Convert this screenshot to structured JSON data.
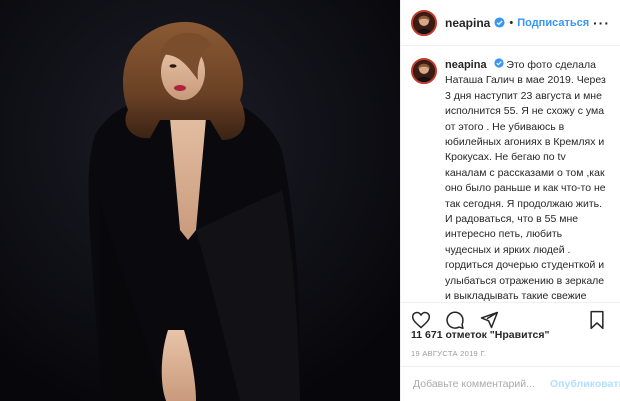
{
  "post": {
    "username": "neapina",
    "verified_icon": "verified-badge-icon",
    "separator": "•",
    "follow_label": "Подписаться",
    "more_label": "···",
    "caption_text": "Это фото сделала Наташа Галич в мае 2019. Через 3 дня наступит 23 августа и мне исполнится 55. Я не схожу с ума от этого . Не убиваюсь в юбилейных агониях в Кремлях и Крокусах. Не бегаю по tv каналам с рассказами о том ,как оно было раньше и как что-то не так сегодня. Я продолжаю жить. И радоваться, что в 55 мне интересно петь, любить чудесных и ярких людей . гордиться дочерью студенткой и улыбаться отражению в зеркале и выкладывать такие свежие фото! А всё остальное- просто цифры, мишура и чьи-то ( не ваши!) правила! Я стану ещё счастливее, если вы 23.08 напишите мне несколько слов про Алёну Апину. Это и будет самый лучший",
    "likes_text": "11 671 отметок \"Нравится\"",
    "date_text": "19 АВГУСТА 2019 Г.",
    "comment_placeholder": "Добавьте комментарий...",
    "publish_label": "Опубликовать"
  },
  "icons": {
    "like": "heart-icon",
    "comment": "comment-icon",
    "share": "share-icon",
    "save": "bookmark-icon"
  },
  "colors": {
    "link_blue": "#3897f0",
    "publish_disabled": "#b2dffc",
    "photo_background": "#0b0b10"
  }
}
